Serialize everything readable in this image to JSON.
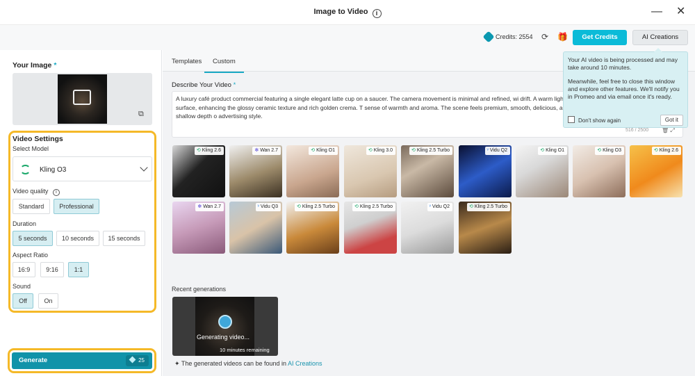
{
  "window": {
    "title": "Image to Video",
    "minimize": "—",
    "close": "✕"
  },
  "topbar": {
    "credits_label": "Credits: 2554",
    "get_credits": "Get Credits",
    "ai_creations": "AI Creations"
  },
  "left": {
    "your_image": "Your Image",
    "required_star": "*",
    "video_settings": "Video Settings",
    "select_model": "Select Model",
    "model_value": "Kling O3",
    "video_quality": "Video quality",
    "quality_options": [
      "Standard",
      "Professional"
    ],
    "quality_selected": "Professional",
    "duration": "Duration",
    "duration_options": [
      "5 seconds",
      "10 seconds",
      "15 seconds"
    ],
    "duration_selected": "5 seconds",
    "aspect_ratio": "Aspect Ratio",
    "aspect_options": [
      "16:9",
      "9:16",
      "1:1"
    ],
    "aspect_selected": "1:1",
    "sound": "Sound",
    "sound_options": [
      "Off",
      "On"
    ],
    "sound_selected": "Off",
    "generate": "Generate",
    "generate_cost": "25"
  },
  "tabs": [
    "Templates",
    "Custom"
  ],
  "active_tab": "Custom",
  "describe": {
    "label": "Describe Your Video",
    "text": "A luxury café product commercial featuring a single elegant latte cup on a saucer. The camera movement is minimal and refined, wi drift. A warm light sweep moves across the cup and coffee surface, enhancing the glossy ceramic texture and rich golden crema. T sense of warmth and aroma. The scene feels premium, smooth, delicious, and highly appetizing. Cinematic lighting, shallow depth o advertising style.",
    "counter": "516 / 2500"
  },
  "templates": [
    {
      "model": "Kling 2.6",
      "icon": "kling"
    },
    {
      "model": "Wan 2.7",
      "icon": "wan"
    },
    {
      "model": "Kling O1",
      "icon": "kling"
    },
    {
      "model": "Kling 3.0",
      "icon": "kling"
    },
    {
      "model": "Kling 2.5 Turbo",
      "icon": "kling"
    },
    {
      "model": "Vidu Q2",
      "icon": "vidu"
    },
    {
      "model": "Kling O1",
      "icon": "kling"
    },
    {
      "model": "Kling O3",
      "icon": "kling"
    },
    {
      "model": "Kling 2.6",
      "icon": "kling"
    },
    {
      "model": "Wan 2.7",
      "icon": "wan"
    },
    {
      "model": "Vidu Q3",
      "icon": "vidu"
    },
    {
      "model": "Kling 2.5 Turbo",
      "icon": "kling"
    },
    {
      "model": "Kling 2.5 Turbo",
      "icon": "kling"
    },
    {
      "model": "Vidu Q2",
      "icon": "vidu"
    },
    {
      "model": "Kling 2.5 Turbo",
      "icon": "kling"
    }
  ],
  "recent": {
    "label": "Recent generations",
    "status": "Generating video...",
    "remaining": "10 minutes remaining",
    "footer_text": "The generated videos can be found in",
    "footer_link": "AI Creations"
  },
  "tooltip": {
    "line1": "Your AI video is being processed and may take around 10 minutes.",
    "line2": "Meanwhile, feel free to close this window and explore other features. We'll notify you in Promeo and via email once it's ready.",
    "dont_show": "Don't show again",
    "got_it": "Got it"
  },
  "colors": {
    "accent": "#1193a9",
    "highlight_border": "#f5b928",
    "get_credits": "#0bbbd8"
  }
}
